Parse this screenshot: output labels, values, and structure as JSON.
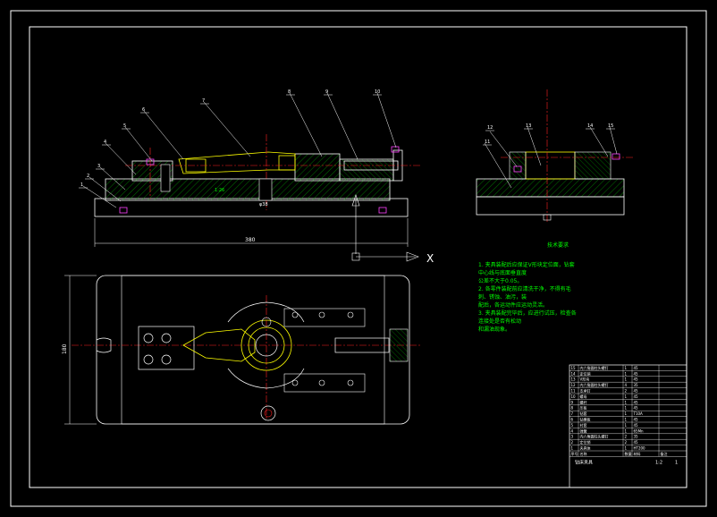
{
  "drawing": {
    "part_numbers": [
      "1",
      "2",
      "3",
      "4",
      "5",
      "6",
      "7",
      "8",
      "9",
      "10",
      "11",
      "12",
      "13",
      "14",
      "15"
    ],
    "overall_length": "380",
    "height_dim": "180",
    "diameter_dim": "φ38",
    "small_dim": "1:26",
    "axis_label": "X",
    "notes_title": "技术要求",
    "notes": [
      "1. 夹具装配后应保证V形块定位面，钻套中心线与底面垂直度",
      "公差不大于0.05。",
      "2. 各零件装配前应清洗干净，不得有毛刺、锈蚀、油污，装",
      "配后，各运动件应运动灵活。",
      "3. 夹具装配完毕后，应进行试压，检查各连接处是否有松动",
      "和漏油现象。"
    ],
    "title_block": {
      "rows": [
        [
          "15",
          "内六角圆柱头螺钉",
          "1",
          "45",
          ""
        ],
        [
          "14",
          "定位销",
          "1",
          "45",
          ""
        ],
        [
          "13",
          "V形块",
          "1",
          "45",
          ""
        ],
        [
          "12",
          "内六角圆柱头螺钉",
          "4",
          "35",
          ""
        ],
        [
          "11",
          "支承钉",
          "2",
          "45",
          ""
        ],
        [
          "10",
          "螺母",
          "1",
          "45",
          ""
        ],
        [
          "9",
          "螺杆",
          "1",
          "45",
          ""
        ],
        [
          "8",
          "压板",
          "1",
          "45",
          ""
        ],
        [
          "7",
          "钻套",
          "1",
          "T10A",
          ""
        ],
        [
          "6",
          "钻模板",
          "1",
          "45",
          ""
        ],
        [
          "5",
          "衬套",
          "1",
          "45",
          ""
        ],
        [
          "4",
          "弹簧",
          "1",
          "65Mn",
          ""
        ],
        [
          "3",
          "内六角圆柱头螺钉",
          "2",
          "35",
          ""
        ],
        [
          "2",
          "定位销",
          "2",
          "45",
          ""
        ],
        [
          "1",
          "夹具体",
          "1",
          "HT200",
          ""
        ]
      ],
      "header": [
        "序号",
        "名称",
        "数量",
        "材料",
        "备注"
      ],
      "title": "钻床夹具",
      "scale": "1:2",
      "sheet": "1"
    }
  }
}
